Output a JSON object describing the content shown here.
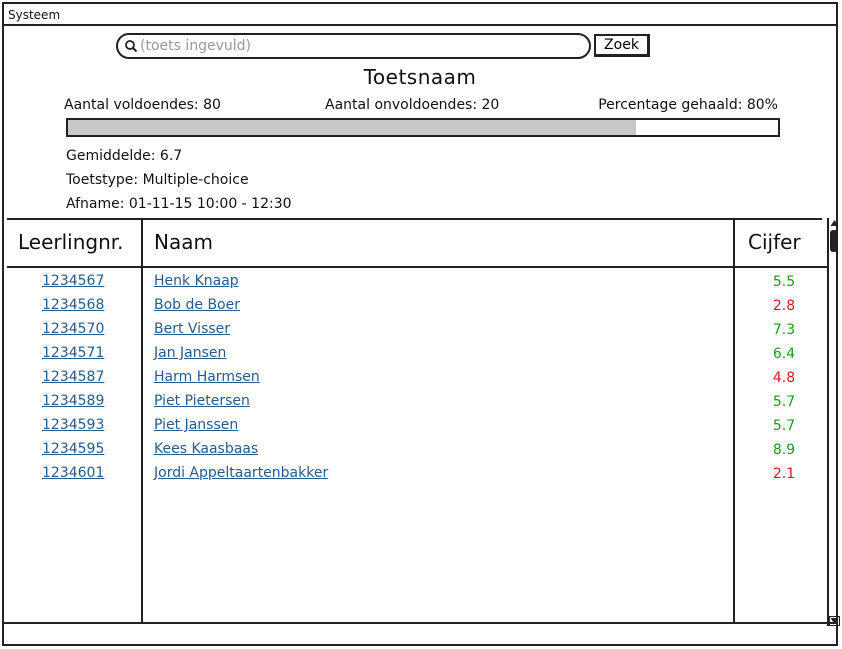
{
  "window": {
    "title": "Systeem"
  },
  "search": {
    "placeholder": "(toets ingevuld)",
    "button_label": "Zoek"
  },
  "test": {
    "title": "Toetsnaam",
    "passes_label": "Aantal voldoendes: 80",
    "fails_label": "Aantal onvoldoendes: 20",
    "percentage_label": "Percentage gehaald: 80%",
    "pass_fraction": 0.8,
    "average_label": "Gemiddelde: 6.7",
    "type_label": "Toetstype: Multiple-choice",
    "date_label": "Afname: 01-11-15 10:00 - 12:30"
  },
  "table": {
    "columns": [
      "Leerlingnr.",
      "Naam",
      "Cijfer"
    ],
    "rows": [
      {
        "id": "1234567",
        "name": "Henk Knaap",
        "grade": "5.5",
        "pass": true
      },
      {
        "id": "1234568",
        "name": "Bob de Boer",
        "grade": "2.8",
        "pass": false
      },
      {
        "id": "1234570",
        "name": "Bert Visser",
        "grade": "7.3",
        "pass": true
      },
      {
        "id": "1234571",
        "name": "Jan Jansen",
        "grade": "6.4",
        "pass": true
      },
      {
        "id": "1234587",
        "name": "Harm Harmsen",
        "grade": "4.8",
        "pass": false
      },
      {
        "id": "1234589",
        "name": "Piet Pietersen",
        "grade": "5.7",
        "pass": true
      },
      {
        "id": "1234593",
        "name": "Piet Janssen",
        "grade": "5.7",
        "pass": true
      },
      {
        "id": "1234595",
        "name": "Kees Kaasbaas",
        "grade": "8.9",
        "pass": true
      },
      {
        "id": "1234601",
        "name": "Jordi Appeltaartenbakker",
        "grade": "2.1",
        "pass": false
      }
    ]
  },
  "colors": {
    "pass": "#1a9a1a",
    "fail": "#d02020",
    "link": "#2a5a8a"
  }
}
